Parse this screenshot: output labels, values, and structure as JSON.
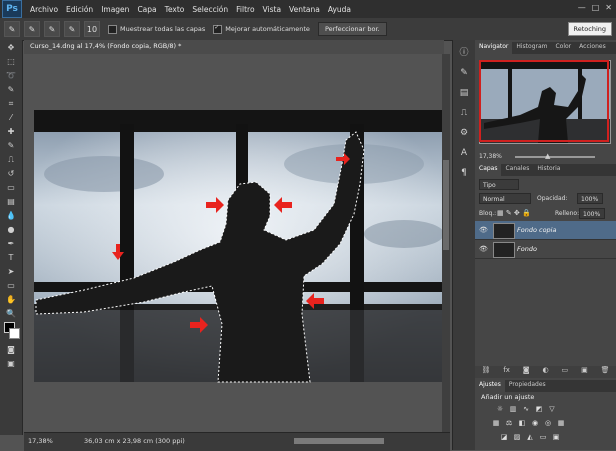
{
  "menubar": {
    "logo": "Ps",
    "items": [
      "Archivo",
      "Edición",
      "Imagen",
      "Capa",
      "Texto",
      "Selección",
      "Filtro",
      "Vista",
      "Ventana",
      "Ayuda"
    ],
    "win_controls": [
      "—",
      "□",
      "✕"
    ]
  },
  "options": {
    "sample_all_label": "Muestrear todas las capas",
    "auto_enhance_label": "Mejorar automáticamente",
    "refine_label": "Perfeccionar bor.",
    "brush_size": "10",
    "workspace": "Retoching"
  },
  "document": {
    "tab_title": "Curso_14.dng al 17,4% (Fondo copia, RGB/8) *"
  },
  "status": {
    "zoom": "17,38%",
    "info": "36,03 cm x 23,98 cm (300 ppi)"
  },
  "navigator": {
    "tabs": [
      "Navigator",
      "Histogram",
      "Color",
      "Acciones"
    ],
    "zoom": "17,38%"
  },
  "layers": {
    "tabs": [
      "Capas",
      "Canales",
      "Historia"
    ],
    "filter": "Tipo",
    "blend_mode": "Normal",
    "opacity_label": "Opacidad:",
    "opacity": "100%",
    "lock_label": "Bloq.:",
    "fill_label": "Relleno:",
    "fill": "100%",
    "items": [
      {
        "name": "Fondo copia"
      },
      {
        "name": "Fondo"
      }
    ]
  },
  "adjustments": {
    "tabs": [
      "Ajustes",
      "Propiedades"
    ],
    "title": "Añadir un ajuste"
  },
  "colors": {
    "selection_arrow": "#e8231e",
    "layer_selected": "#4f6b89",
    "sky": "#9fb1c4"
  }
}
